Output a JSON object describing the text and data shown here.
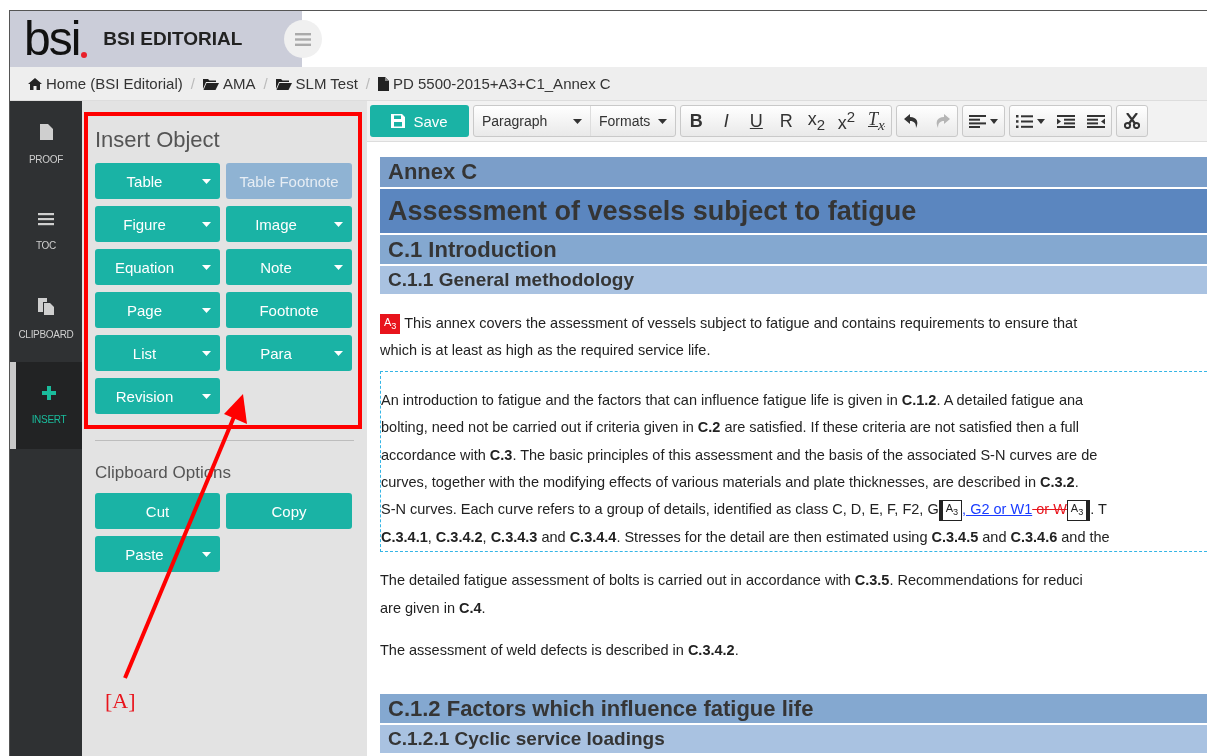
{
  "brand": {
    "logo": "bsi",
    "name": "BSI EDITORIAL"
  },
  "breadcrumb": {
    "separator": "/",
    "items": [
      {
        "label": "Home (BSI Editorial)"
      },
      {
        "label": "AMA"
      },
      {
        "label": "SLM Test"
      },
      {
        "label": "PD 5500-2015+A3+C1_Annex C"
      }
    ]
  },
  "nav": [
    {
      "label": "PROOF",
      "selected": false
    },
    {
      "label": "TOC",
      "selected": false
    },
    {
      "label": "CLIPBOARD",
      "selected": false
    },
    {
      "label": "INSERT",
      "selected": true
    }
  ],
  "panel": {
    "sections": [
      {
        "title": "Insert Object",
        "buttons": [
          {
            "label": "Table",
            "dropdown": true,
            "disabled": false
          },
          {
            "label": "Table Footnote",
            "dropdown": false,
            "disabled": true
          },
          {
            "label": "Figure",
            "dropdown": true,
            "disabled": false
          },
          {
            "label": "Image",
            "dropdown": true,
            "disabled": false
          },
          {
            "label": "Equation",
            "dropdown": true,
            "disabled": false
          },
          {
            "label": "Note",
            "dropdown": true,
            "disabled": false
          },
          {
            "label": "Page",
            "dropdown": true,
            "disabled": false
          },
          {
            "label": "Footnote",
            "dropdown": false,
            "disabled": false
          },
          {
            "label": "List",
            "dropdown": true,
            "disabled": false
          },
          {
            "label": "Para",
            "dropdown": true,
            "disabled": false
          },
          {
            "label": "Revision",
            "dropdown": true,
            "disabled": false
          }
        ]
      },
      {
        "title": "Clipboard Options",
        "buttons": [
          {
            "label": "Cut",
            "dropdown": false,
            "disabled": false
          },
          {
            "label": "Copy",
            "dropdown": false,
            "disabled": false
          },
          {
            "label": "Paste",
            "dropdown": true,
            "disabled": false
          }
        ]
      }
    ]
  },
  "toolbar": {
    "save": "Save",
    "groups": [
      [
        {
          "kind": "select",
          "label": "Paragraph"
        },
        {
          "kind": "select",
          "label": "Formats"
        }
      ],
      [
        {
          "kind": "bold",
          "label": "B"
        },
        {
          "kind": "italic",
          "label": "I"
        },
        {
          "kind": "underline",
          "label": "U"
        },
        {
          "kind": "plain",
          "label": "R"
        },
        {
          "kind": "plain",
          "label": "x$_{2}$"
        },
        {
          "kind": "plain",
          "label": "x$^{2}$"
        },
        {
          "kind": "clear",
          "label": "T$_{x}$"
        }
      ],
      [
        {
          "kind": "undo",
          "disabled": false
        },
        {
          "kind": "redo",
          "disabled": true
        }
      ],
      [
        {
          "kind": "align",
          "disabled": false
        }
      ],
      [
        {
          "kind": "list",
          "disabled": false
        },
        {
          "kind": "indent",
          "disabled": false
        },
        {
          "kind": "outdent",
          "disabled": false
        }
      ],
      [
        {
          "kind": "cut",
          "disabled": false
        }
      ]
    ]
  },
  "document": [
    {
      "kind": "annex",
      "text": "Annex C"
    },
    {
      "kind": "title",
      "text": "Assessment of vessels subject to fatigue"
    },
    {
      "kind": "h1",
      "text": "C.1 Introduction"
    },
    {
      "kind": "h2",
      "text": "C.1.1 General methodology"
    },
    {
      "kind": "para",
      "focused": false,
      "lines": [
        [
          {
            "kind": "marker-red",
            "text": "A$_{3}$"
          },
          {
            "kind": "text",
            "text": " This annex covers the assessment of vessels subject to fatigue and contains requirements to ensure that"
          }
        ],
        [
          {
            "kind": "text",
            "text": "which is at least as high as the required service life."
          }
        ]
      ]
    },
    {
      "kind": "para",
      "focused": true,
      "lines": [
        [
          {
            "kind": "text",
            "text": "An introduction to fatigue and the factors that can influence fatigue life is given in **C.1.2**. A detailed fatigue ana"
          }
        ],
        [
          {
            "kind": "text",
            "text": "bolting, need not be carried out if criteria given in **C.2** are satisfied. If these criteria are not satisfied then a full"
          }
        ],
        [
          {
            "kind": "text",
            "text": "accordance with **C.3**. The basic principles of this assessment and the basis of the associated S-N curves are de"
          }
        ],
        [
          {
            "kind": "text",
            "text": "curves, together with the modifying effects of various materials and plate thicknesses, are described in **C.3.2**."
          }
        ],
        [
          {
            "kind": "text",
            "text": "S-N curves. Each curve refers to a group of details, identified as class C, D, E, F, F2, G"
          },
          {
            "kind": "marker-start",
            "text": "A$_{3}$"
          },
          {
            "kind": "insertion",
            "text": ", G2 or W1"
          },
          {
            "kind": "deletion",
            "text": " or W"
          },
          {
            "kind": "marker-end",
            "text": "A$_{3}$"
          },
          {
            "kind": "text",
            "text": ". T"
          }
        ],
        [
          {
            "kind": "text",
            "text": "**C.3.4.1**, **C.3.4.2**, **C.3.4.3** and **C.3.4.4**. Stresses for the detail are then estimated using **C.3.4.5** and **C.3.4.6** and the"
          }
        ]
      ]
    },
    {
      "kind": "para",
      "focused": false,
      "lines": [
        [
          {
            "kind": "text",
            "text": "The detailed fatigue assessment of bolts is carried out in accordance with **C.3.5**. Recommendations for reduci"
          }
        ],
        [
          {
            "kind": "text",
            "text": "are given in **C.4**."
          }
        ]
      ]
    },
    {
      "kind": "para",
      "focused": false,
      "lines": [
        [
          {
            "kind": "text",
            "text": "The assessment of weld defects is described in **C.3.4.2**."
          }
        ]
      ]
    },
    {
      "kind": "h1",
      "text": "C.1.2 Factors which influence fatigue life"
    },
    {
      "kind": "h2",
      "text": "C.1.2.1 Cyclic service loadings"
    }
  ],
  "annotation": {
    "label": "[A]"
  }
}
